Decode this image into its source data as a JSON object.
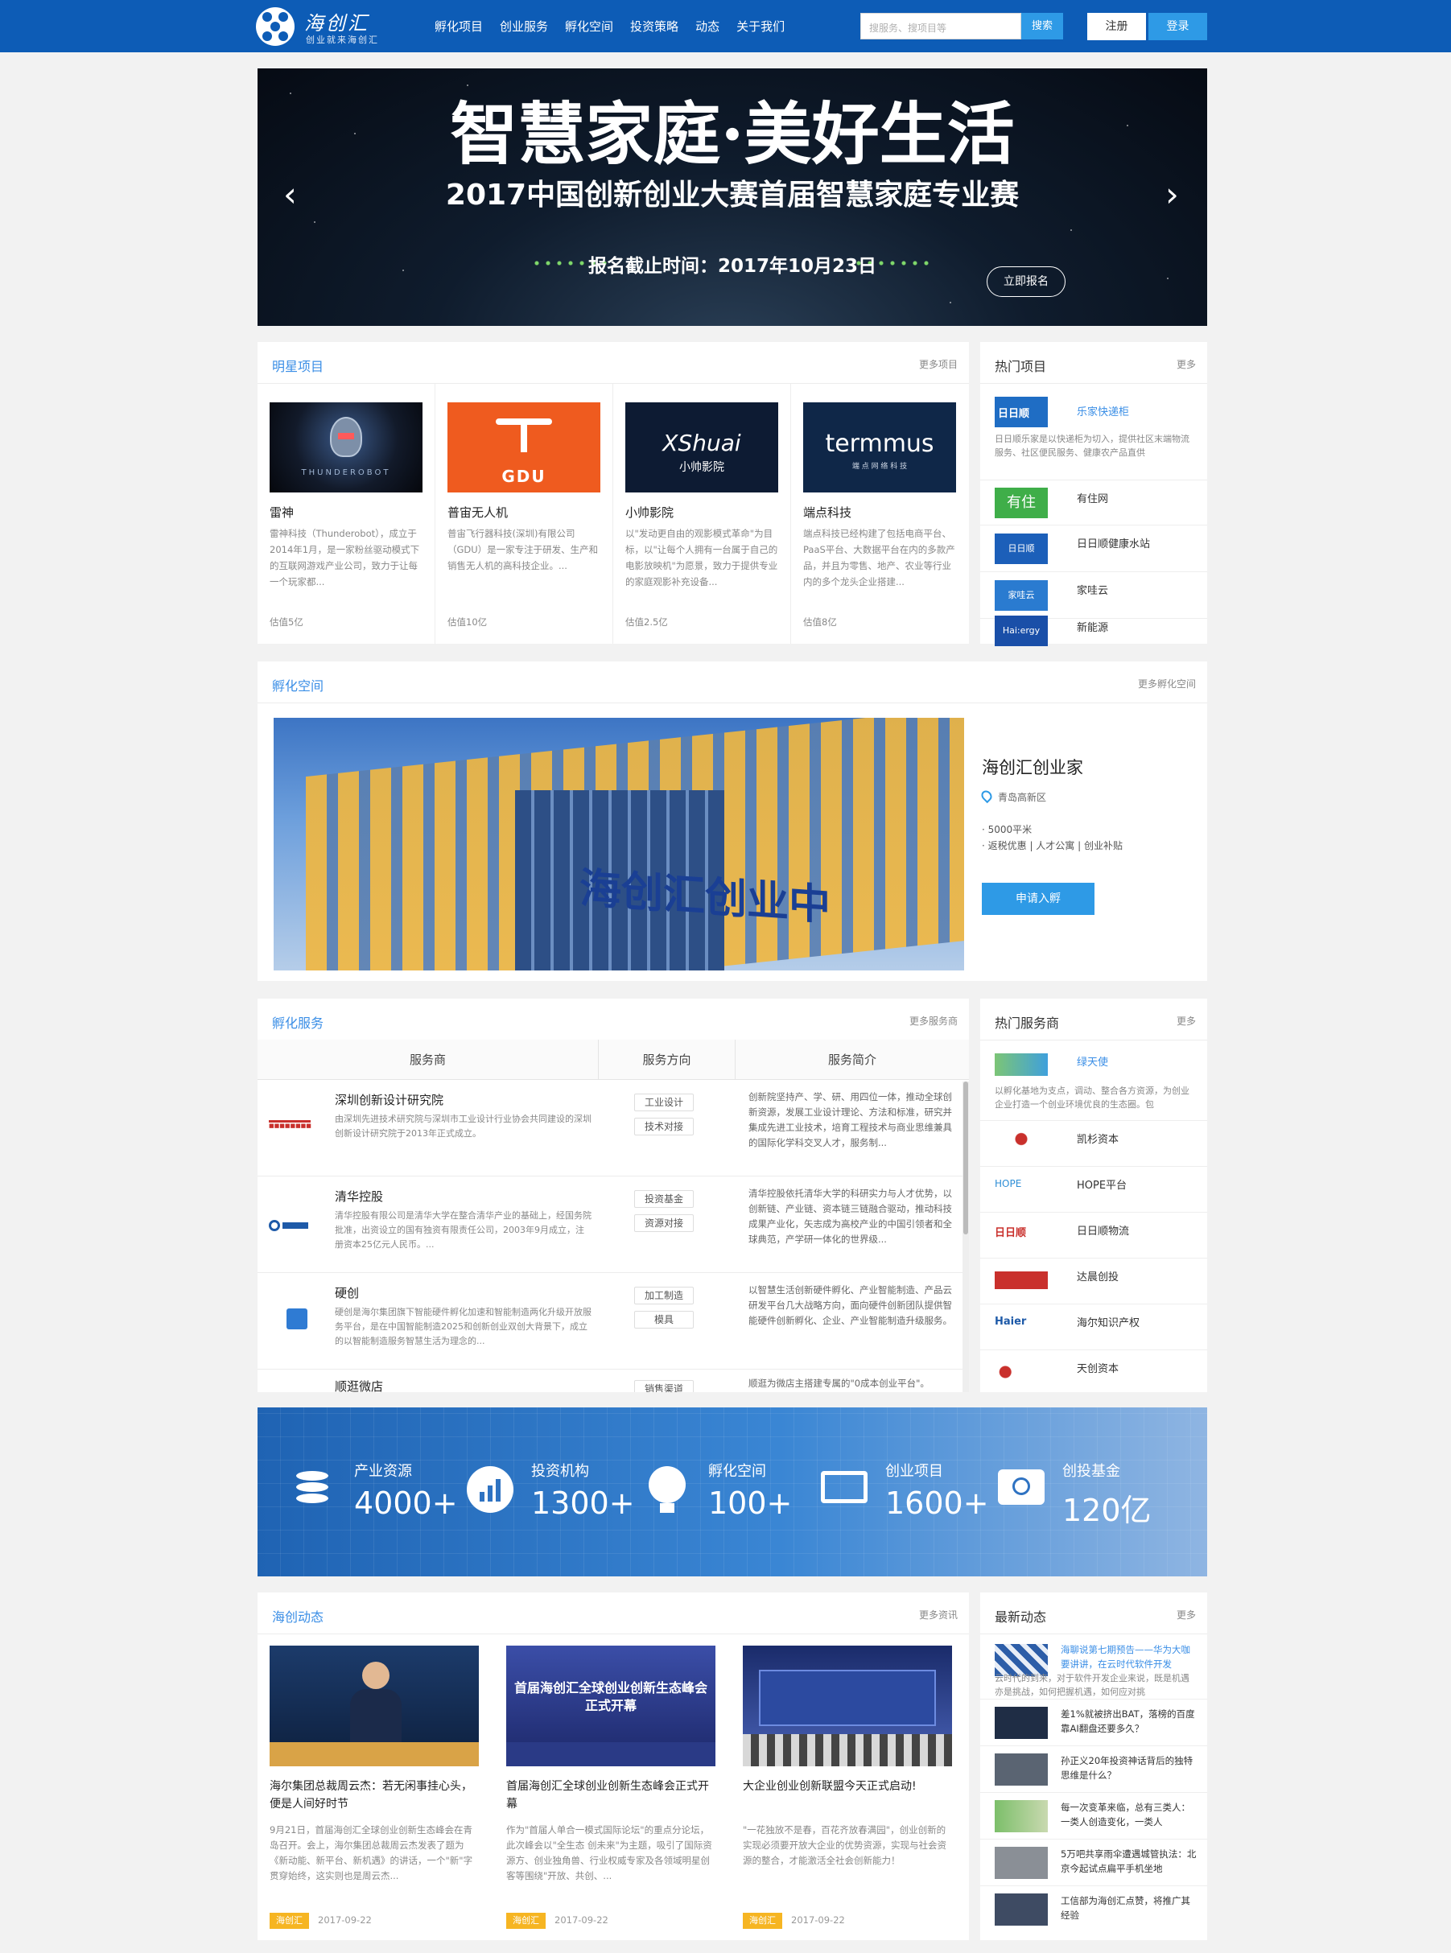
{
  "header": {
    "logo_title": "海创汇",
    "logo_slogan": "创业就来海创汇",
    "nav": [
      "孵化项目",
      "创业服务",
      "孵化空间",
      "投资策略",
      "动态",
      "关于我们"
    ],
    "search_placeholder": "搜服务、搜项目等",
    "search_button": "搜索",
    "register": "注册",
    "login": "登录"
  },
  "banner": {
    "title": "智慧家庭·美好生活",
    "subtitle": "2017中国创新创业大赛首届智慧家庭专业赛",
    "deadline": "报名截止时间：2017年10月23日",
    "cta": "立即报名",
    "prev": "‹",
    "next": "›"
  },
  "star_projects": {
    "title": "明星项目",
    "more": "更多项目",
    "items": [
      {
        "name": "雷神",
        "desc": "雷神科技（Thunderobot），成立于2014年1月，是一家粉丝驱动模式下的互联网游戏产业公司，致力于让每一个玩家都...",
        "value": "估值5亿",
        "logo_text": "THUNDEROBOT"
      },
      {
        "name": "普宙无人机",
        "desc": "普宙飞行器科技(深圳)有限公司（GDU）是一家专注于研发、生产和销售无人机的高科技企业。...",
        "value": "估值10亿",
        "logo_text": "GDU"
      },
      {
        "name": "小帅影院",
        "desc": "以\"发动更自由的观影模式革命\"为目标，以\"让每个人拥有一台属于自己的电影放映机\"为愿景，致力于提供专业的家庭观影补充设备...",
        "value": "估值2.5亿",
        "logo_text": "XShuai",
        "logo_sub": "小帅影院"
      },
      {
        "name": "端点科技",
        "desc": "端点科技已经构建了包括电商平台、PaaS平台、大数据平台在内的多款产品，并且为零售、地产、农业等行业内的多个龙头企业搭建...",
        "value": "估值8亿",
        "logo_text": "termmus",
        "logo_sub": "端 点 网 络 科 技"
      }
    ]
  },
  "hot_projects": {
    "title": "热门项目",
    "more": "更多",
    "featured": {
      "name": "乐家快递柜",
      "desc": "日日顺乐家是以快递柜为切入，提供社区末端物流服务、社区便民服务、健康农产品直供"
    },
    "items": [
      {
        "name": "有住网",
        "logo": "有住"
      },
      {
        "name": "日日顺健康水站",
        "logo": "日日顺"
      },
      {
        "name": "家哇云",
        "logo": "家哇云"
      },
      {
        "name": "新能源",
        "logo": "Hai:ergy"
      }
    ]
  },
  "incubator": {
    "title": "孵化空间",
    "more": "更多孵化空间",
    "name": "海创汇创业家",
    "location": "青岛高新区",
    "features": [
      "· 5000平米",
      "· 返税优惠 | 人才公寓 | 创业补贴"
    ],
    "apply": "申请入孵",
    "sign_text": "海创汇创业中"
  },
  "services": {
    "title": "孵化服务",
    "more": "更多服务商",
    "headers": [
      "服务商",
      "服务方向",
      "服务简介"
    ],
    "rows": [
      {
        "name": "深圳创新设计研究院",
        "desc": "由深圳先进技术研究院与深圳市工业设计行业协会共同建设的深圳创新设计研究院于2013年正式成立。",
        "tags": [
          "工业设计",
          "技术对接"
        ],
        "intro": "创新院坚持产、学、研、用四位一体，推动全球创新资源，发展工业设计理论、方法和标准，研究并集成先进工业技术，培育工程技术与商业思维兼具的国际化学科交叉人才，服务制..."
      },
      {
        "name": "清华控股",
        "desc": "清华控股有限公司是清华大学在整合清华产业的基础上，经国务院批准，出资设立的国有独资有限责任公司，2003年9月成立，注册资本25亿元人民币。...",
        "tags": [
          "投资基金",
          "资源对接"
        ],
        "intro": "清华控股依托清华大学的科研实力与人才优势，以创新链、产业链、资本链三链融合驱动，推动科技成果产业化，矢志成为高校产业的中国引领者和全球典范，产学研一体化的世界级..."
      },
      {
        "name": "硬创",
        "desc": "硬创是海尔集团旗下智能硬件孵化加速和智能制造两化升级开放服务平台，是在中国智能制造2025和创新创业双创大背景下，成立的以智能制造服务智慧生活为理念的...",
        "tags": [
          "加工制造",
          "模具"
        ],
        "intro": "以智慧生活创新硬件孵化、产业智能制造、产品云研发平台几大战略方向，面向硬件创新团队提供智能硬件创新孵化、企业、产业智能制造升级服务。"
      },
      {
        "name": "顺逛微店",
        "desc": "",
        "tags": [
          "销售渠道"
        ],
        "intro": "顺逛为微店主搭建专属的\"0成本创业平台\"。"
      }
    ]
  },
  "hot_providers": {
    "title": "热门服务商",
    "more": "更多",
    "featured": {
      "name": "绿天使",
      "desc": "以孵化基地为支点，调动、整合各方资源，为创业企业打造一个创业环境优良的生态圈。包"
    },
    "items": [
      {
        "name": "凯杉资本"
      },
      {
        "name": "HOPE平台"
      },
      {
        "name": "日日顺物流"
      },
      {
        "name": "达晨创投"
      },
      {
        "name": "海尔知识产权"
      },
      {
        "name": "天创资本"
      }
    ]
  },
  "stats": [
    {
      "label": "产业资源",
      "value": "4000+"
    },
    {
      "label": "投资机构",
      "value": "1300+"
    },
    {
      "label": "孵化空间",
      "value": "100+"
    },
    {
      "label": "创业项目",
      "value": "1600+"
    },
    {
      "label": "创投基金",
      "value": "120亿"
    }
  ],
  "news": {
    "title": "海创动态",
    "more": "更多资讯",
    "items": [
      {
        "title": "海尔集团总裁周云杰：若无闲事挂心头，便是人间好时节",
        "desc": "9月21日，首届海创汇全球创业创新生态峰会在青岛召开。会上，海尔集团总裁周云杰发表了题为《新动能、新平台、新机遇》的讲话，一个\"新\"字贯穿始终，这实则也是周云杰...",
        "tag": "海创汇",
        "date": "2017-09-22"
      },
      {
        "title": "首届海创汇全球创业创新生态峰会正式开幕",
        "desc": "作为\"首届人单合一模式国际论坛\"的重点分论坛，此次峰会以\"全生态 创未来\"为主题，吸引了国际资源方、创业独角兽、行业权威专家及各领域明星创客等围绕\"开放、共创、...",
        "tag": "海创汇",
        "date": "2017-09-22"
      },
      {
        "title": "大企业创业创新联盟今天正式启动!",
        "desc": "\"一花独放不是春，百花齐放春满园\"，创业创新的实现必须要开放大企业的优势资源，实现与社会资源的整合，才能激活全社会创新能力！",
        "tag": "海创汇",
        "date": "2017-09-22"
      }
    ]
  },
  "latest": {
    "title": "最新动态",
    "more": "更多",
    "featured": {
      "title": "海聊说第七期预告——华为大咖要讲讲，在云时代软件开发",
      "desc": "云时代的到来，对于软件开发企业来说，既是机遇亦是挑战，如何把握机遇，如何应对挑"
    },
    "items": [
      "差1%就被挤出BAT，落榜的百度靠AI翻盘还要多久？",
      "孙正义20年投资神话背后的独特思维是什么？",
      "每一次变革来临，总有三类人：一类人创造变化，一类人",
      "5万吧共享雨伞遭遇城管执法：北京今起试点扁平手机坐地",
      "工信部为海创汇点赞，将推广其经验"
    ]
  },
  "colors": {
    "topbar": "#0d5cb6",
    "accent": "#2e9ae6",
    "link": "#3a8ee6",
    "tag": "#f6b522"
  }
}
